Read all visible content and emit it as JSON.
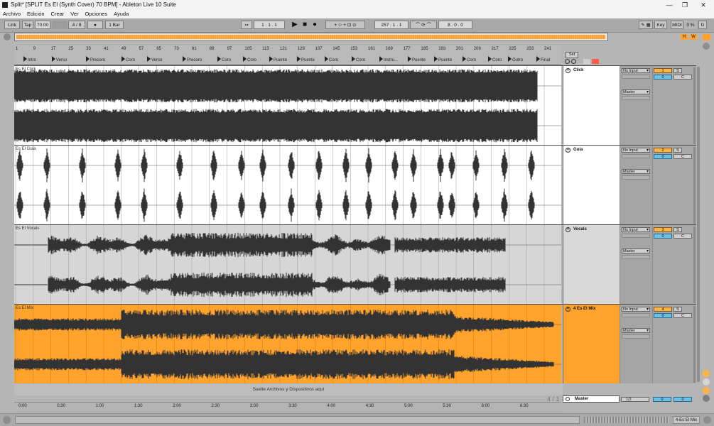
{
  "window": {
    "title": "Split* [SPLIT Es El (Synth Cover) 70 BPM] - Ableton Live 10 Suite",
    "minimize": "—",
    "maximize": "❐",
    "close": "✕"
  },
  "menu": [
    "Archivo",
    "Edición",
    "Crear",
    "Ver",
    "Opciones",
    "Ayuda"
  ],
  "control_bar": {
    "link": "Link",
    "tap": "Tap",
    "tempo": "70.00",
    "signature": "4 / 8",
    "metronome": "●",
    "quantize": "1 Bar",
    "position": "1 .  1 .  1",
    "play_icon": "▶",
    "stop_icon": "■",
    "record_icon": "●",
    "loop_start": "257 .  1 .  1",
    "loop_length": "8 .  0 .  0",
    "key": "Key",
    "midi": "MIDI",
    "cpu": "0 %",
    "disk": "D",
    "h": "H",
    "w": "W"
  },
  "bar_numbers": [
    "1",
    "9",
    "17",
    "25",
    "33",
    "41",
    "49",
    "57",
    "65",
    "73",
    "81",
    "89",
    "97",
    "105",
    "113",
    "121",
    "129",
    "137",
    "145",
    "153",
    "161",
    "169",
    "177",
    "185",
    "193",
    "201",
    "209",
    "217",
    "225",
    "233",
    "241"
  ],
  "locators": [
    "Intro",
    "Verso",
    "Precoro",
    "Coro",
    "Verso",
    "Precoro",
    "Coro",
    "Coro",
    "Puente",
    "Puente",
    "Coro",
    "Coro",
    "Instru...",
    "Puente",
    "Puente",
    "Coro",
    "Coro",
    "Outro",
    "Final"
  ],
  "set_label": "Set",
  "tracks": [
    {
      "clip": "Es El Click",
      "name": "Click",
      "input": "No Input",
      "output": "Master",
      "number": "1",
      "solo": "S",
      "volume": "0",
      "pan": "C",
      "color": "#ffffff",
      "lane_color": "#ffffff"
    },
    {
      "clip": "Es El Guia",
      "name": "Guia",
      "input": "No Input",
      "output": "Master",
      "number": "2",
      "solo": "S",
      "volume": "0",
      "pan": "C",
      "color": "#ffffff",
      "lane_color": "#ffffff"
    },
    {
      "clip": "Es El Vocals",
      "name": "Vocals",
      "input": "No Input",
      "output": "Master",
      "number": "3",
      "solo": "S",
      "volume": "0",
      "pan": "C",
      "color": "#d9d9d9",
      "lane_color": "#d6d6d6"
    },
    {
      "clip": "Es El Mix",
      "name": "4 Es El Mix",
      "input": "No Input",
      "output": "Master",
      "number": "4",
      "solo": "S",
      "volume": "0",
      "pan": "C",
      "color": "#ffa32d",
      "lane_color": "#ffa32d"
    }
  ],
  "drop_zone": "Suelte Archivos y Dispositivos aquí",
  "zoom_ratio": "4 / 1",
  "master": {
    "name": "Master",
    "routing": "1/2",
    "volume": "0",
    "pan": "0"
  },
  "time_labels": [
    "0:00",
    "0:30",
    "1:00",
    "1:30",
    "2:00",
    "2:30",
    "3:00",
    "3:30",
    "4:00",
    "4:30",
    "5:00",
    "5:30",
    "6:00",
    "6:30"
  ],
  "status": {
    "selected_track": "4-Es El Mix"
  }
}
